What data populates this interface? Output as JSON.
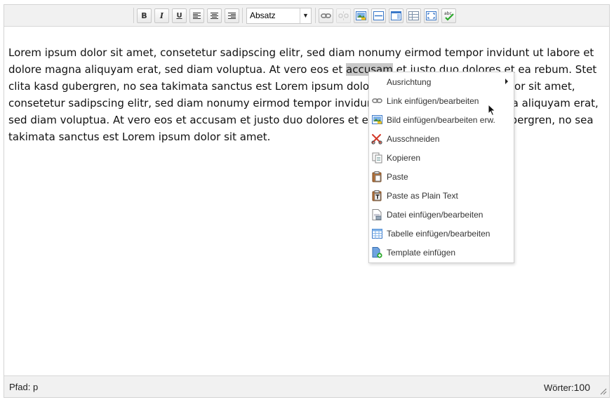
{
  "toolbar": {
    "format_select_value": "Absatz",
    "format_select_arrow": "▼",
    "bold_label": "B",
    "italic_label": "I",
    "underline_label": "U",
    "buttons": [
      {
        "name": "bold-button",
        "icon": "bold-icon"
      },
      {
        "name": "italic-button",
        "icon": "italic-icon"
      },
      {
        "name": "underline-button",
        "icon": "underline-icon"
      },
      {
        "name": "align-left-button",
        "icon": "align-left-icon"
      },
      {
        "name": "align-center-button",
        "icon": "align-center-icon"
      },
      {
        "name": "align-right-button",
        "icon": "align-right-icon"
      },
      {
        "name": "link-button",
        "icon": "link-icon"
      },
      {
        "name": "unlink-button",
        "icon": "unlink-icon",
        "disabled": true
      },
      {
        "name": "image-button",
        "icon": "image-icon"
      },
      {
        "name": "horizontal-rule-button",
        "icon": "horizontal-rule-icon"
      },
      {
        "name": "template-button",
        "icon": "template-icon"
      },
      {
        "name": "table-button",
        "icon": "table-icon"
      },
      {
        "name": "fullscreen-button",
        "icon": "fullscreen-icon"
      },
      {
        "name": "spellcheck-button",
        "icon": "spellcheck-icon"
      }
    ],
    "spellcheck_text": "abc"
  },
  "content": {
    "text_before": "Lorem ipsum dolor sit amet, consetetur sadipscing elitr, sed diam nonumy eirmod tempor invidunt ut labore et dolore magna aliquyam erat, sed diam voluptua. At vero eos et ",
    "selected_word": "accusam",
    "text_after": " et justo duo dolores et ea rebum. Stet clita kasd gubergren, no sea takimata sanctus est Lorem ipsum dolor sit amet. Lorem ipsum dolor sit amet, consetetur sadipscing elitr, sed diam nonumy eirmod tempor invidunt ut labore et dolore magna aliquyam erat, sed diam voluptua. At vero eos et accusam et justo duo dolores et ea rebum. Stet clita kasd gubergren, no sea takimata sanctus est Lorem ipsum dolor sit amet."
  },
  "context_menu": {
    "items": [
      {
        "label": "Ausrichtung",
        "icon": "none",
        "has_submenu": true
      },
      {
        "label": "Link einfügen/bearbeiten",
        "icon": "link-icon"
      },
      {
        "label": "Bild einfügen/bearbeiten erw.",
        "icon": "image-icon"
      },
      {
        "label": "Ausschneiden",
        "icon": "scissors-icon"
      },
      {
        "label": "Kopieren",
        "icon": "copy-icon"
      },
      {
        "label": "Paste",
        "icon": "paste-icon"
      },
      {
        "label": "Paste as Plain Text",
        "icon": "paste-plain-text-icon"
      },
      {
        "label": "Datei einfügen/bearbeiten",
        "icon": "file-icon"
      },
      {
        "label": "Tabelle einfügen/bearbeiten",
        "icon": "table-icon"
      },
      {
        "label": "Template einfügen",
        "icon": "template-add-icon"
      }
    ]
  },
  "statusbar": {
    "path_label": "Pfad: p",
    "word_count_label": "Wörter:",
    "word_count_value": "100"
  },
  "colors": {
    "toolbar_bg": "#f1f1f1",
    "selection_bg": "#c8c8c8",
    "icon_blue": "#3a78c9"
  }
}
